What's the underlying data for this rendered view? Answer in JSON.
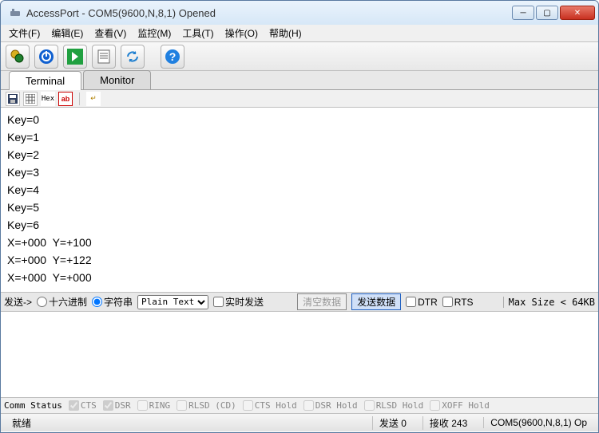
{
  "window": {
    "title": "AccessPort - COM5(9600,N,8,1) Opened"
  },
  "menu": {
    "file": "文件(F)",
    "edit": "编辑(E)",
    "view": "查看(V)",
    "monitor": "监控(M)",
    "tools": "工具(T)",
    "operate": "操作(O)",
    "help": "帮助(H)"
  },
  "tabs": {
    "terminal": "Terminal",
    "monitor": "Monitor"
  },
  "toolbar2": {
    "hex": "Hex",
    "ab": "ab"
  },
  "terminal_lines": [
    "Key=0",
    "Key=1",
    "Key=2",
    "Key=3",
    "Key=4",
    "Key=5",
    "Key=6",
    "X=+000  Y=+100",
    "X=+000  Y=+122",
    "X=+000  Y=+000"
  ],
  "send": {
    "label": "发送->",
    "hex": "十六进制",
    "str": "字符串",
    "format": "Plain Text",
    "realtime": "实时发送",
    "clear": "清空数据",
    "sendbtn": "发送数据",
    "dtr": "DTR",
    "rts": "RTS",
    "maxsize": "Max Size < 64KB"
  },
  "comm": {
    "label": "Comm Status",
    "cts": "CTS",
    "dsr": "DSR",
    "ring": "RING",
    "rlsd": "RLSD (CD)",
    "ctshold": "CTS Hold",
    "dsrhold": "DSR Hold",
    "rlsdhold": "RLSD Hold",
    "xoffhold": "XOFF Hold"
  },
  "status": {
    "ready": "就绪",
    "tx": "发送 0",
    "rx": "接收 243",
    "port": "COM5(9600,N,8,1) Op"
  }
}
